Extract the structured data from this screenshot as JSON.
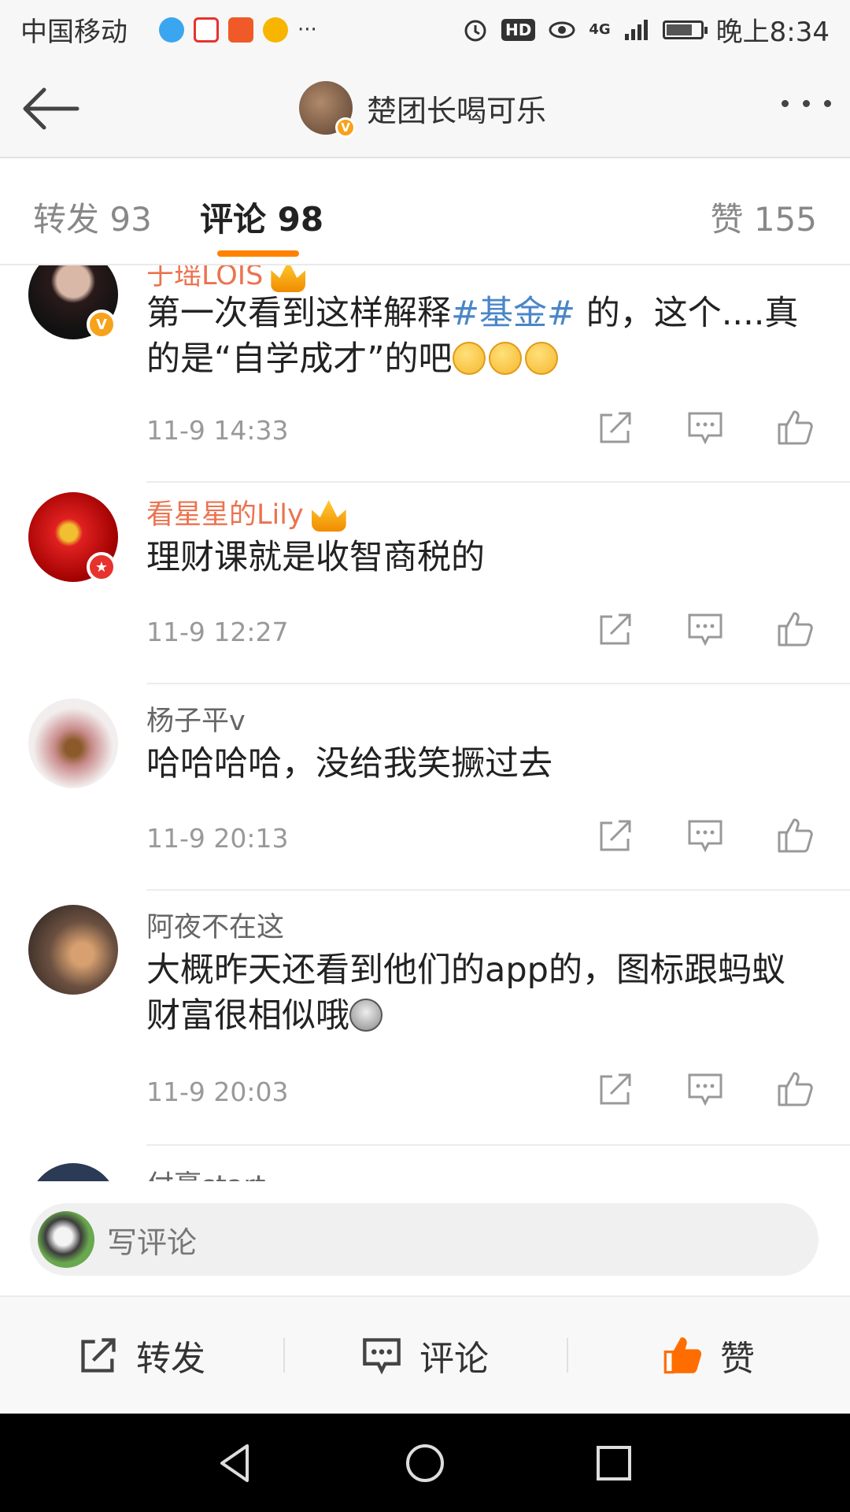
{
  "status_bar": {
    "carrier": "中国移动",
    "apps": [
      {
        "icon": "browser-app-icon",
        "color": "#3aa6f0"
      },
      {
        "icon": "sina-app-icon",
        "color": "#e8322d"
      },
      {
        "icon": "pingan-securities-app-icon",
        "color": "#f05a28"
      },
      {
        "icon": "weibo-app-icon",
        "color": "#f7b500"
      }
    ],
    "more": "···",
    "hd": "HD",
    "network": "4G",
    "time": "晚上8:34"
  },
  "header": {
    "title": "楚团长喝可乐",
    "verified": "V"
  },
  "tabs": {
    "repost": "转发 93",
    "comment": "评论 98",
    "like": "赞 155",
    "accent": "#ff8200"
  },
  "comments": [
    {
      "user": "于瑶LOIS",
      "vip": true,
      "badge": "V",
      "badge_color": "#f7a21b",
      "text_prefix": "第一次看到这样解释",
      "topic": "#基金#",
      "text_suffix": " 的，这个....真的是“自学成才”的吧",
      "emoji_count": 3,
      "time": "11-9 14:33"
    },
    {
      "user": "看星星的Lily",
      "vip": true,
      "badge": "★",
      "badge_color": "#e8322d",
      "text": "理财课就是收智商税的",
      "time": "11-9 12:27"
    },
    {
      "user": "杨子平v",
      "vip": false,
      "text": "哈哈哈哈，没给我笑撅过去",
      "time": "11-9 20:13"
    },
    {
      "user": "阿夜不在这",
      "vip": false,
      "text": "大概昨天还看到他们的app的，图标跟蚂蚁财富很相似哦",
      "time": "11-9 20:03"
    },
    {
      "user": "付豪start",
      "vip": false
    }
  ],
  "input": {
    "placeholder": "写评论"
  },
  "action_bar": {
    "repost": "转发",
    "comment": "评论",
    "like": "赞",
    "like_color": "#ff6d00"
  }
}
